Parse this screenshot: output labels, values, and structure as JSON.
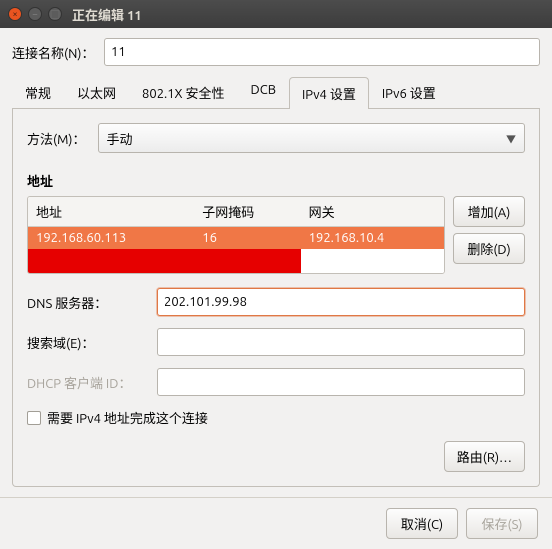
{
  "window": {
    "title": "正在编辑 11"
  },
  "connection": {
    "label": "连接名称(N)：",
    "value": "11"
  },
  "tabs": [
    "常规",
    "以太网",
    "802.1X 安全性",
    "DCB",
    "IPv4 设置",
    "IPv6 设置"
  ],
  "active_tab": 4,
  "method": {
    "label": "方法(M)：",
    "value": "手动"
  },
  "address": {
    "section_title": "地址",
    "headers": [
      "地址",
      "子网掩码",
      "网关"
    ],
    "rows": [
      {
        "addr": "192.168.60.113",
        "mask": "16",
        "gw": "192.168.10.4",
        "selected": true
      },
      {
        "addr": "",
        "mask": "",
        "gw": "",
        "editing": true
      }
    ],
    "add_btn": "增加(A)",
    "del_btn": "删除(D)"
  },
  "dns": {
    "label": "DNS 服务器：",
    "value": "202.101.99.98"
  },
  "search": {
    "label": "搜索域(E)：",
    "value": ""
  },
  "dhcp": {
    "label": "DHCP 客户端 ID：",
    "value": ""
  },
  "require_chk": "需要 IPv4 地址完成这个连接",
  "route_btn": "路由(R)…",
  "footer": {
    "cancel": "取消(C)",
    "save": "保存(S)"
  }
}
